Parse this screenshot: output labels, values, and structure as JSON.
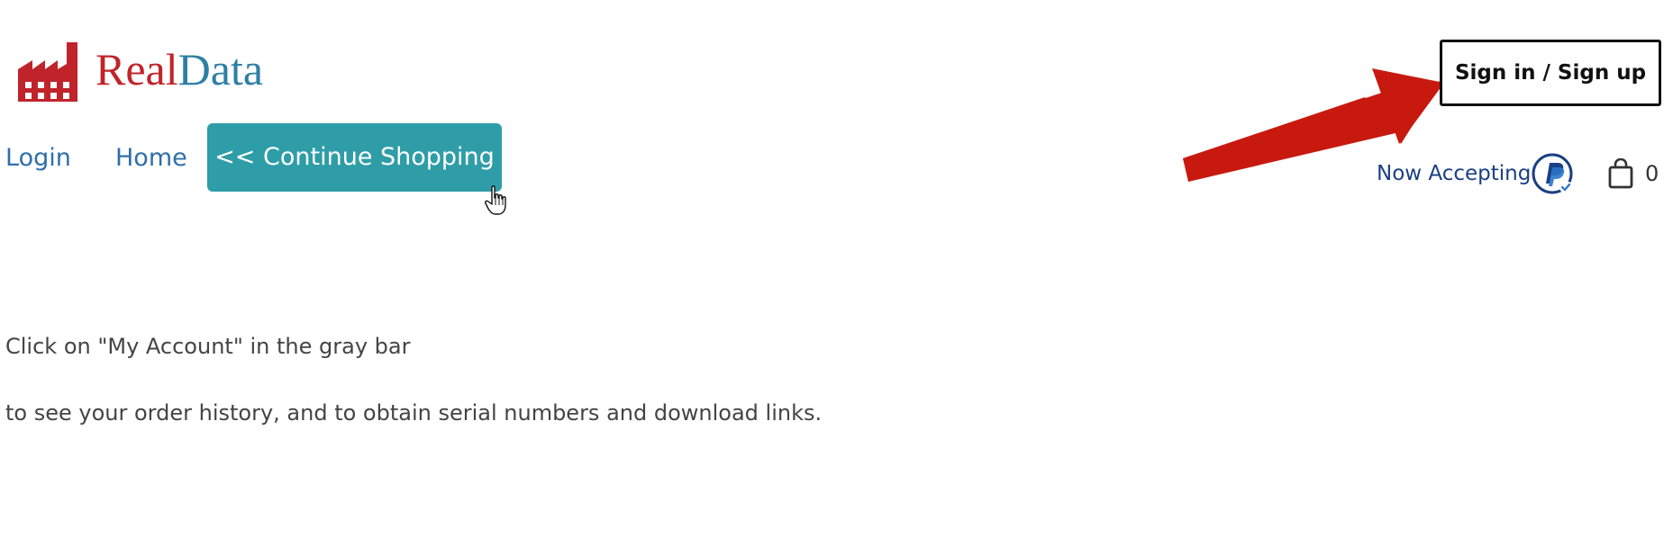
{
  "header": {
    "logo": {
      "name_part1": "Real",
      "name_part2": "Data",
      "icon": "factory-icon"
    },
    "signin_label": "Sign in / Sign up",
    "now_accepting_label": "Now Accepting",
    "payment_icon": "paypal-icon",
    "cart_icon": "shopping-bag-icon",
    "cart_count": "0"
  },
  "nav": {
    "login_label": "Login",
    "home_label": "Home",
    "continue_label": "<< Continue Shopping"
  },
  "main": {
    "line1": "Click on \"My Account\" in the gray bar",
    "line2": "to see your order history, and to obtain serial numbers and download links."
  },
  "annotations": {
    "arrow_icon": "red-arrow-icon",
    "arrow_color": "#c8190f",
    "cursor_icon": "hand-cursor-icon"
  },
  "colors": {
    "logo_red": "#c0242a",
    "logo_blue": "#2e7fa5",
    "link_blue": "#2f6fa8",
    "button_teal": "#2f9da7",
    "paypal_navy": "#1b3f84"
  }
}
